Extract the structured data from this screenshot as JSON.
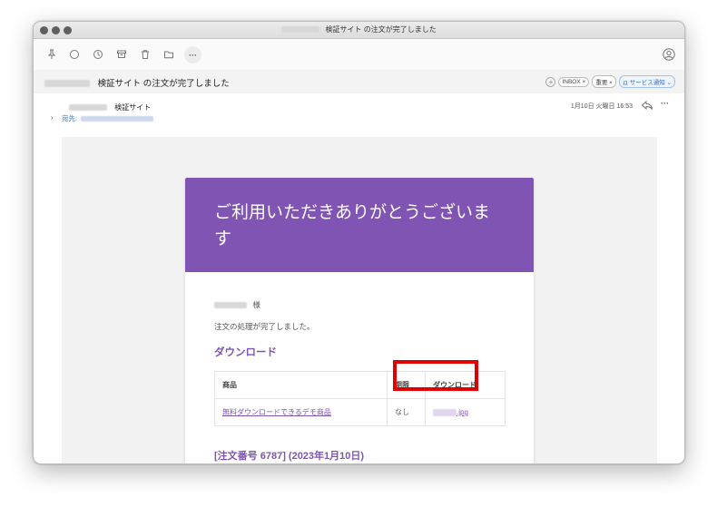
{
  "window": {
    "title": "検証サイト の注文が完了しました"
  },
  "toolbar": {
    "more_label": "···"
  },
  "subject": {
    "text": "検証サイト の注文が完了しました",
    "labels": [
      "INBOX ×",
      "重要 ×",
      "サービス通知 ⌄"
    ]
  },
  "message": {
    "sender": "検証サイト",
    "to_label": "宛先:",
    "date": "1月10日 火曜日 16:53",
    "more_label": "···"
  },
  "email": {
    "hero_title": "ご利用いただきありがとうございます",
    "hero_color": "#7f54b3",
    "honorific": "様",
    "processed": "注文の処理が完了しました。",
    "download_heading": "ダウンロード",
    "table": {
      "headers": [
        "商品",
        "期限",
        "ダウンロード"
      ],
      "rows": [
        {
          "product": "無料ダウンロードできるデモ商品",
          "expiry": "なし",
          "file_ext": ".jpg"
        }
      ]
    },
    "order_heading": "[注文番号 6787] (2023年1月10日)"
  },
  "colors": {
    "accent": "#7f54b3",
    "highlight_box": "#e00000",
    "link_blue": "#3b78c9"
  }
}
